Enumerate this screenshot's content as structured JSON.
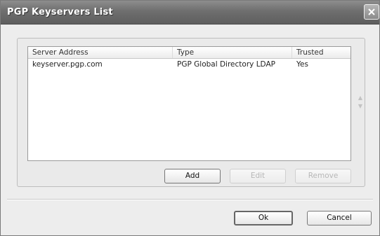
{
  "window": {
    "title": "PGP Keyservers List"
  },
  "list": {
    "columns": [
      "Server Address",
      "Type",
      "Trusted"
    ],
    "rows": [
      {
        "address": "keyserver.pgp.com",
        "type": "PGP Global Directory LDAP",
        "trusted": "Yes"
      }
    ]
  },
  "buttons": {
    "add": "Add",
    "edit": "Edit",
    "remove": "Remove",
    "ok": "Ok",
    "cancel": "Cancel"
  },
  "icons": {
    "close": "close-icon",
    "up": "arrow-up-icon",
    "down": "arrow-down-icon"
  }
}
